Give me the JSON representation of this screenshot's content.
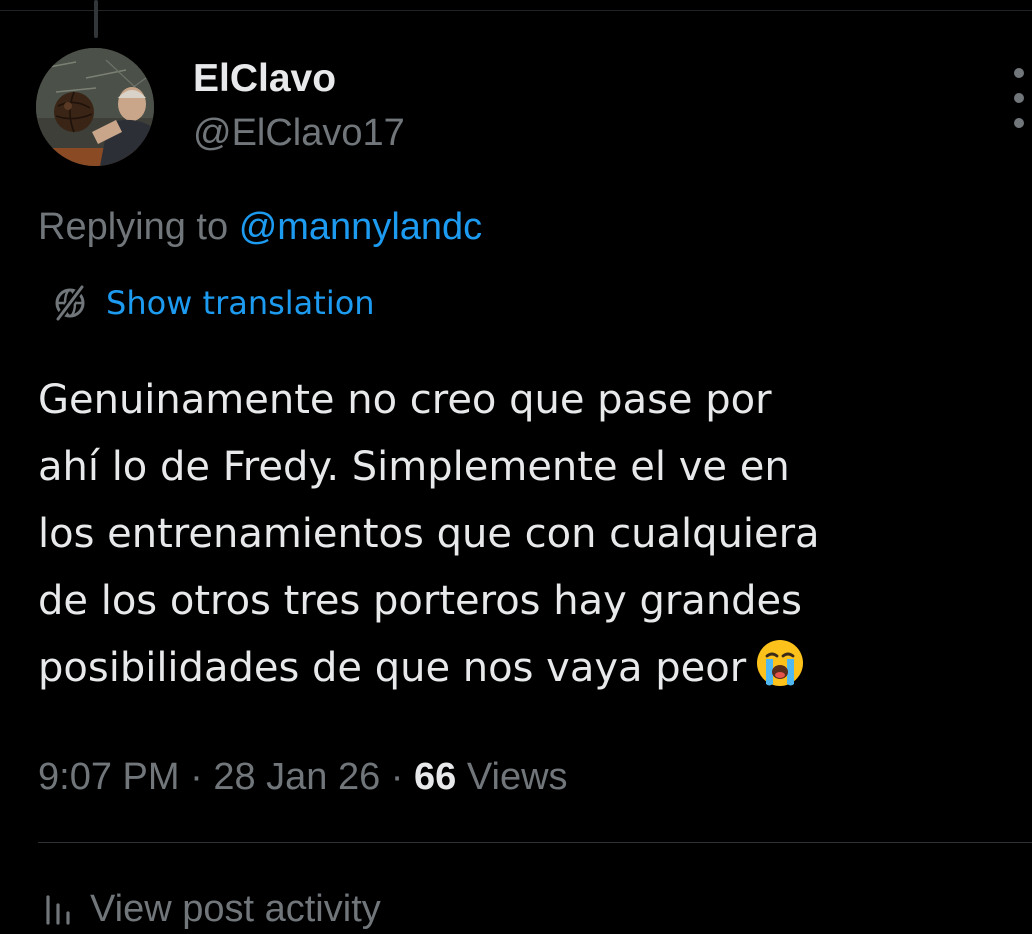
{
  "post": {
    "author": {
      "display_name": "ElClavo",
      "handle": "@ElClavo17"
    },
    "replying_prefix": "Replying to",
    "replying_to": "@mannylandc",
    "translate_label": "Show translation",
    "text_lines": [
      "Genuinamente no creo que pase por",
      "ahí lo de Fredy. Simplemente el ve en",
      "los entrenamientos que con cualquiera",
      "de los otros tres porteros hay grandes",
      "posibilidades de que nos vaya peor"
    ],
    "emoji": "loudly-crying-face",
    "time": "9:07 PM",
    "date": "28 Jan 26",
    "separator": "·",
    "views_count": "66",
    "views_label": "Views",
    "activity_label": "View post activity"
  },
  "icons": {
    "more": "more-horizontal-icon",
    "translate": "globe-icon",
    "activity": "bar-chart-icon"
  },
  "colors": {
    "background": "#000000",
    "text_primary": "#e7e9ea",
    "text_secondary": "#71767b",
    "accent": "#1d9bf0",
    "divider": "#2f3336"
  }
}
